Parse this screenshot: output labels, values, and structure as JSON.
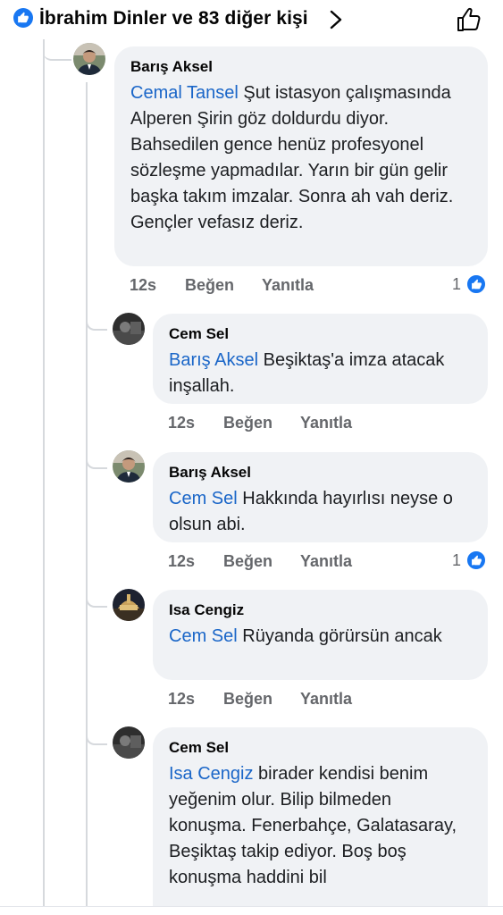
{
  "header": {
    "reactors_title": "İbrahim Dinler ve 83 diğer kişi"
  },
  "icons": {
    "reaction": "thumbs-up-icon",
    "chevron": "chevron-right-icon",
    "like_button": "thumbs-up-outline-icon"
  },
  "colors": {
    "accent": "#1877f2",
    "mention": "#1a66c8",
    "bubble": "#f0f2f5",
    "meta": "#65676b"
  },
  "comments": [
    {
      "author": "Barış Aksel",
      "mention": "Cemal Tansel",
      "text": " Şut istasyon çalışmasında Alperen Şirin göz doldurdu diyor. Bahsedilen gence henüz profesyonel sözleşme yapmadılar. Yarın bir gün gelir başka takım imzalar. Sonra ah vah deriz. Gençler vefasız deriz.",
      "time": "12s",
      "like": "Beğen",
      "reply": "Yanıtla",
      "reactions": "1"
    },
    {
      "author": "Cem Sel",
      "mention": "Barış Aksel",
      "text": " Beşiktaş'a imza atacak inşallah.",
      "time": "12s",
      "like": "Beğen",
      "reply": "Yanıtla",
      "reactions": ""
    },
    {
      "author": "Barış Aksel",
      "mention": "Cem Sel",
      "text": " Hakkında hayırlısı neyse o olsun abi.",
      "time": "12s",
      "like": "Beğen",
      "reply": "Yanıtla",
      "reactions": "1"
    },
    {
      "author": "Isa Cengiz",
      "mention": "Cem Sel",
      "text": " Rüyanda görürsün ancak",
      "time": "12s",
      "like": "Beğen",
      "reply": "Yanıtla",
      "reactions": ""
    },
    {
      "author": "Cem Sel",
      "mention": "Isa Cengiz",
      "text": " birader kendisi benim yeğenim olur. Bilip bilmeden konuşma. Fenerbahçe, Galatasaray, Beşiktaş takip ediyor. Boş boş konuşma haddini bil",
      "time": "",
      "like": "",
      "reply": "",
      "reactions": ""
    }
  ]
}
